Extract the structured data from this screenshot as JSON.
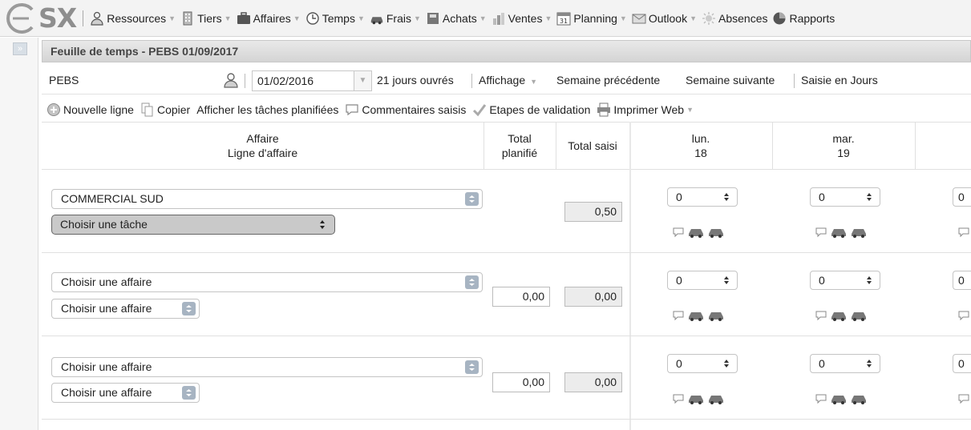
{
  "app": {
    "logo": "SX"
  },
  "menu": [
    {
      "label": "Ressources",
      "icon": "users-icon",
      "dropdown": true
    },
    {
      "label": "Tiers",
      "icon": "building-icon",
      "dropdown": true
    },
    {
      "label": "Affaires",
      "icon": "briefcase-icon",
      "dropdown": true
    },
    {
      "label": "Temps",
      "icon": "clock-icon",
      "dropdown": true
    },
    {
      "label": "Frais",
      "icon": "car-icon",
      "dropdown": true
    },
    {
      "label": "Achats",
      "icon": "book-icon",
      "dropdown": true
    },
    {
      "label": "Ventes",
      "icon": "chart-icon",
      "dropdown": true
    },
    {
      "label": "Planning",
      "icon": "calendar-icon",
      "dropdown": true
    },
    {
      "label": "Outlook",
      "icon": "mail-icon",
      "dropdown": true
    },
    {
      "label": "Absences",
      "icon": "sun-icon",
      "dropdown": false
    },
    {
      "label": "Rapports",
      "icon": "pie-icon",
      "dropdown": false
    }
  ],
  "panel": {
    "title": "Feuille de temps - PEBS 01/09/2017"
  },
  "toolbar1": {
    "resource": "PEBS",
    "date": "01/02/2016",
    "working_days": "21 jours ouvrés",
    "display": "Affichage",
    "prev_week": "Semaine précédente",
    "next_week": "Semaine suivante",
    "entry_mode": "Saisie en Jours"
  },
  "toolbar2": {
    "new_line": "Nouvelle ligne",
    "copy": "Copier",
    "show_planned": "Afficher les tâches planifiées",
    "comments": "Commentaires saisis",
    "validation": "Etapes de validation",
    "print": "Imprimer Web"
  },
  "columns": {
    "affaire_1": "Affaire",
    "affaire_2": "Ligne d'affaire",
    "planned_1": "Total",
    "planned_2": "planifié",
    "entered": "Total saisi",
    "day1_name": "lun.",
    "day1_num": "18",
    "day2_name": "mar.",
    "day2_num": "19"
  },
  "rows": [
    {
      "affaire": "COMMERCIAL SUD",
      "task": "Choisir une tâche",
      "planned": "",
      "entered": "0,50",
      "day1": "0",
      "day2": "0",
      "day3": "0"
    },
    {
      "affaire": "Choisir une affaire",
      "task": "Choisir une affaire",
      "planned": "0,00",
      "entered": "0,00",
      "day1": "0",
      "day2": "0",
      "day3": "0"
    },
    {
      "affaire": "Choisir une affaire",
      "task": "Choisir une affaire",
      "planned": "0,00",
      "entered": "0,00",
      "day1": "0",
      "day2": "0",
      "day3": "0"
    }
  ],
  "colors": {
    "accent": "#a7b4c2",
    "header_bg": "#d9d9d9"
  }
}
